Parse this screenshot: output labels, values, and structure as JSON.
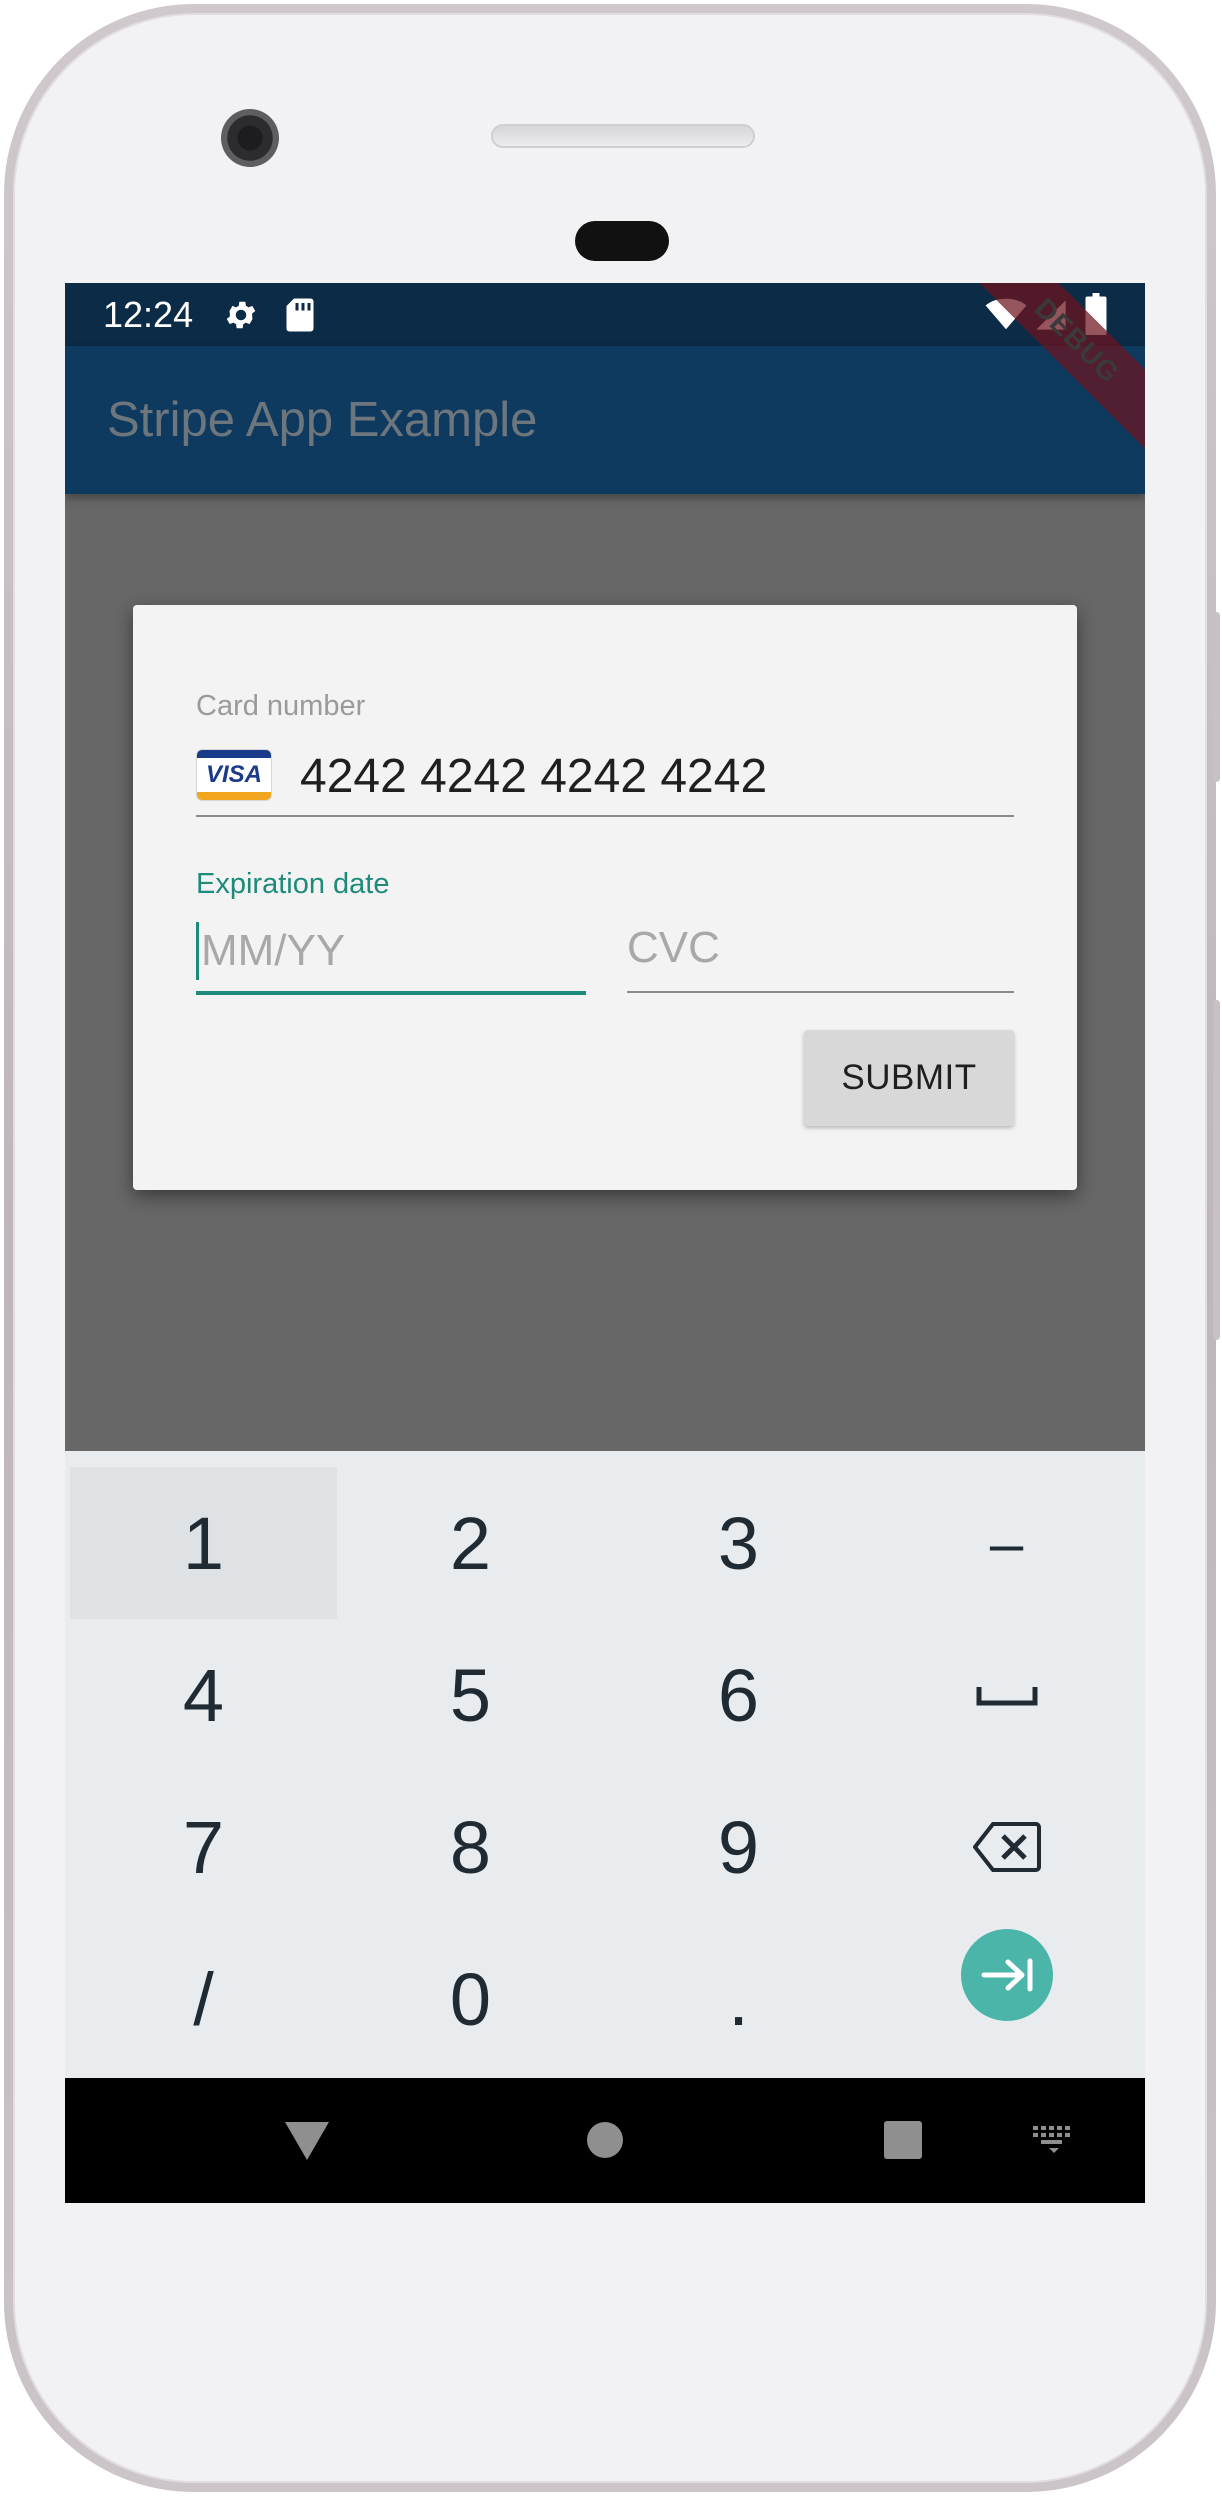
{
  "status_bar": {
    "time": "12:24",
    "icons": [
      "gear-icon",
      "sd-card-icon",
      "wifi-icon",
      "cell-signal-icon",
      "battery-icon"
    ]
  },
  "debug_banner": "DEBUG",
  "app_bar": {
    "title": "Stripe App Example"
  },
  "card_form": {
    "card_number_label": "Card number",
    "card_brand": "VISA",
    "card_number_value": "4242 4242 4242 4242",
    "expiration_label": "Expiration date",
    "expiration_placeholder": "MM/YY",
    "cvc_placeholder": "CVC",
    "submit_label": "SUBMIT"
  },
  "keyboard": {
    "row1": [
      "1",
      "2",
      "3",
      "–"
    ],
    "row2": [
      "4",
      "5",
      "6",
      "space"
    ],
    "row3": [
      "7",
      "8",
      "9",
      "backspace"
    ],
    "row4": [
      "/",
      "0",
      ".",
      "next"
    ]
  },
  "nav_bar": {
    "icons": [
      "back-icon",
      "home-icon",
      "recents-icon",
      "keyboard-switch-icon"
    ]
  },
  "colors": {
    "status_bar": "#0b2b46",
    "app_bar": "#0e3a60",
    "accent": "#1d8a7a",
    "go_button": "#4bb5aa",
    "scrim": "#676767"
  }
}
